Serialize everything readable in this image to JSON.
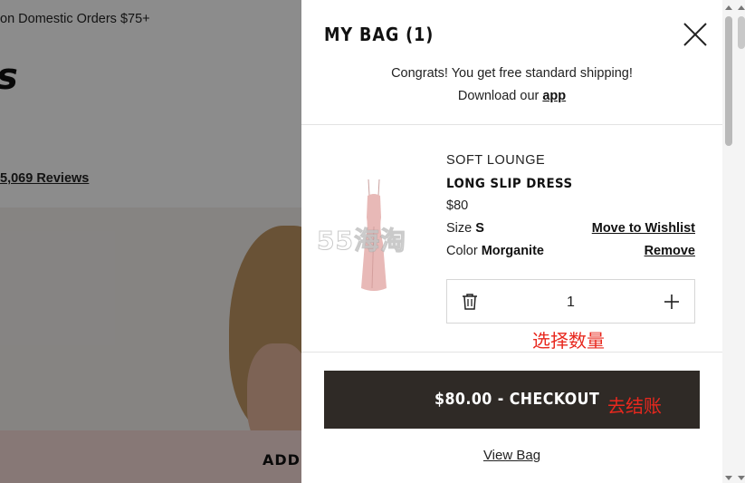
{
  "background_page": {
    "promo_text": "on Domestic Orders $75+",
    "brand_fragment": "s",
    "reviews_text": "5,069 Reviews",
    "add_button_label": "ADD T"
  },
  "bag": {
    "title": "MY BAG (1)",
    "shipping_message": "Congrats! You get free standard shipping!",
    "download_prefix": "Download our ",
    "app_link": "app",
    "item": {
      "brand": "SOFT LOUNGE",
      "name": "LONG SLIP DRESS",
      "price": "$80",
      "size_label": "Size",
      "size_value": "S",
      "color_label": "Color",
      "color_value": "Morganite",
      "move_to_wishlist": "Move to Wishlist",
      "remove": "Remove",
      "quantity": "1"
    },
    "checkout_label": "$80.00 - CHECKOUT",
    "view_bag": "View Bag"
  },
  "annotations": {
    "select_quantity": "选择数量",
    "go_checkout": "去结账",
    "watermark": "55海淘"
  },
  "icons": {
    "close": "close-icon",
    "trash": "trash-icon",
    "plus": "plus-icon"
  },
  "colors": {
    "checkout_bg": "#2f2a26",
    "annotation": "#e8281e",
    "dress": "#e8b9b7"
  }
}
